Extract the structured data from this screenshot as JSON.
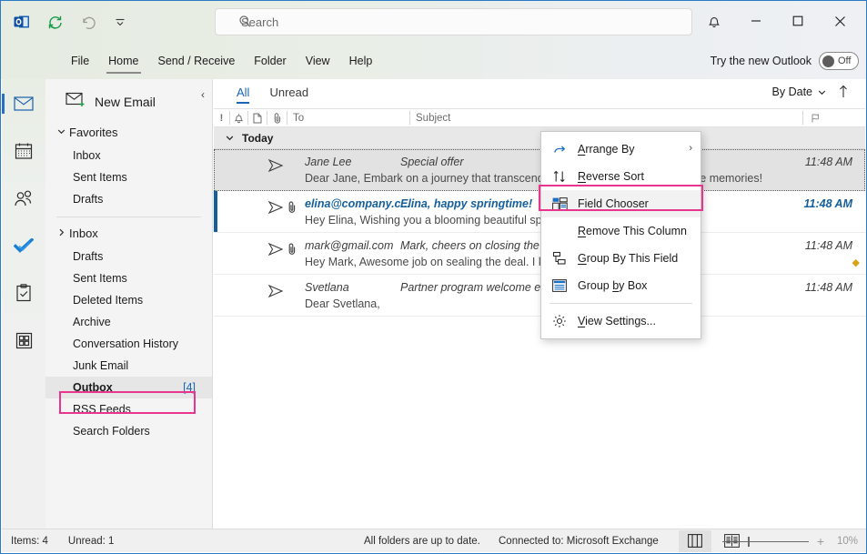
{
  "window": {
    "quick_access": [
      "outlook-logo",
      "send-receive-icon",
      "undo-icon",
      "customize-qat-icon"
    ],
    "search_placeholder": "Search",
    "notifications_icon": "bell-icon",
    "minimize_label": "–",
    "maximize_label": "☐",
    "close_label": "✕",
    "try_new_outlook_label": "Try the new Outlook",
    "try_new_outlook_state": "Off"
  },
  "ribbon": {
    "tabs": [
      {
        "label": "File",
        "active": false
      },
      {
        "label": "Home",
        "active": true
      },
      {
        "label": "Send / Receive",
        "active": false
      },
      {
        "label": "Folder",
        "active": false
      },
      {
        "label": "View",
        "active": false
      },
      {
        "label": "Help",
        "active": false
      }
    ]
  },
  "rail": {
    "items": [
      {
        "name": "mail-icon",
        "selected": true
      },
      {
        "name": "calendar-icon",
        "selected": false
      },
      {
        "name": "people-icon",
        "selected": false
      },
      {
        "name": "todo-icon",
        "selected": false
      },
      {
        "name": "tasks-icon",
        "selected": false
      },
      {
        "name": "apps-icon",
        "selected": false
      }
    ]
  },
  "folder_pane": {
    "new_email_label": "New Email",
    "collapse_icon": "chevron-left-icon",
    "favorites_label": "Favorites",
    "favorites": [
      {
        "label": "Inbox"
      },
      {
        "label": "Sent Items"
      },
      {
        "label": "Drafts"
      }
    ],
    "account_root_label": "Inbox",
    "folders": [
      {
        "label": "Drafts",
        "count": ""
      },
      {
        "label": "Sent Items",
        "count": ""
      },
      {
        "label": "Deleted Items",
        "count": ""
      },
      {
        "label": "Archive",
        "count": ""
      },
      {
        "label": "Conversation History",
        "count": ""
      },
      {
        "label": "Junk Email",
        "count": ""
      },
      {
        "label": "Outbox",
        "count": "[4]",
        "selected": true,
        "highlighted": true
      },
      {
        "label": "RSS Feeds",
        "count": ""
      },
      {
        "label": "Search Folders",
        "count": ""
      }
    ]
  },
  "list_pane": {
    "filters": [
      {
        "label": "All",
        "active": true
      },
      {
        "label": "Unread",
        "active": false
      }
    ],
    "sort_label": "By Date",
    "sort_chevron": "chevron-down-icon",
    "sort_direction_icon": "arrow-up-icon",
    "columns": [
      {
        "name": "importance-column",
        "glyph": "!"
      },
      {
        "name": "reminder-column",
        "glyph": "bell-icon"
      },
      {
        "name": "icon-column",
        "glyph": "page-icon"
      },
      {
        "name": "attachment-column",
        "glyph": "paperclip-icon"
      },
      {
        "name": "to-column",
        "label": "To"
      },
      {
        "name": "subject-column",
        "label": "Subject"
      },
      {
        "name": "flag-column",
        "glyph": "flag-icon"
      }
    ],
    "group_label": "Today",
    "group_chevron": "chevron-down-icon",
    "messages": [
      {
        "to": "Jane Lee",
        "subject": "Special offer",
        "preview": "Dear Jane,  Embark on a journey that transcends time and creates unforgettable memories!",
        "date": "11:48 AM",
        "unread": false,
        "selected": true,
        "attachment": false,
        "flagged": false
      },
      {
        "to": "elina@company.c...",
        "subject": "Elina, happy springtime!",
        "preview": "Hey Elina,  Wishing you a blooming beautiful spring filled with the",
        "date": "11:48 AM",
        "unread": true,
        "selected": false,
        "attachment": true,
        "flagged": false
      },
      {
        "to": "mark@gmail.com",
        "subject": "Mark, cheers on closing the deal!",
        "preview": "Hey Mark,  Awesome job on sealing the deal. I know you worked hard towards",
        "date": "11:48 AM",
        "unread": false,
        "selected": false,
        "attachment": true,
        "flagged": true
      },
      {
        "to": "Svetlana",
        "subject": "Partner program welcome email",
        "preview": "Dear Svetlana,",
        "date": "11:48 AM",
        "unread": false,
        "selected": false,
        "attachment": false,
        "flagged": false
      }
    ]
  },
  "context_menu": {
    "items": [
      {
        "label": "Arrange By",
        "icon": "arrange-by-icon",
        "submenu": true,
        "highlighted": false,
        "accel": "A"
      },
      {
        "label": "Reverse Sort",
        "icon": "reverse-sort-icon",
        "submenu": false,
        "highlighted": false,
        "accel": "R"
      },
      {
        "label": "Field Chooser",
        "icon": "field-chooser-icon",
        "submenu": false,
        "highlighted": true,
        "accel": "C"
      },
      {
        "label": "Remove This Column",
        "icon": "",
        "submenu": false,
        "highlighted": false,
        "accel": "R"
      },
      {
        "label": "Group By This Field",
        "icon": "group-by-field-icon",
        "submenu": false,
        "highlighted": false,
        "accel": "G"
      },
      {
        "label": "Group by Box",
        "icon": "group-by-box-icon",
        "submenu": false,
        "highlighted": false,
        "accel": "b"
      },
      {
        "label": "View Settings...",
        "icon": "gear-icon",
        "submenu": false,
        "highlighted": false,
        "accel": "V"
      }
    ],
    "submenu_glyph": "›"
  },
  "status_bar": {
    "items_label": "Items: 4",
    "unread_label": "Unread: 1",
    "sync_label": "All folders are up to date.",
    "connection_label": "Connected to: Microsoft Exchange",
    "normal_view_icon": "normal-view-icon",
    "reading_view_icon": "reading-view-icon",
    "zoom_plus": "+",
    "zoom_level": "10%"
  },
  "colors": {
    "accent_blue": "#1b64b8",
    "unread_blue": "#15609c",
    "highlight_pink": "#e8368f",
    "titlebar_green": "#e6ece2",
    "selected_row": "#e2e2e2"
  }
}
